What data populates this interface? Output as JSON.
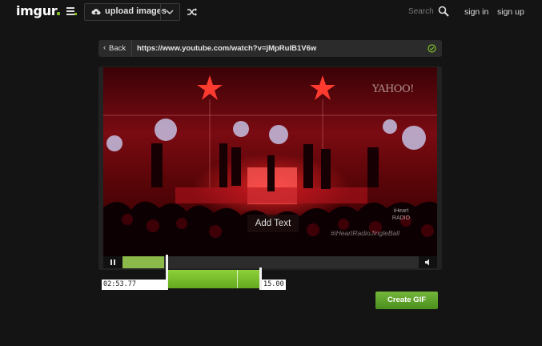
{
  "header": {
    "logo": "imgur",
    "upload_label": "upload images",
    "search_placeholder": "Search",
    "sign_in": "sign in",
    "sign_up": "sign up",
    "icons": {
      "menu": "menu-icon",
      "upload": "cloud-upload-icon",
      "dropdown": "chevron-down-icon",
      "random": "shuffle-icon",
      "search": "search-icon"
    }
  },
  "url_bar": {
    "back_label": "Back",
    "back_glyph": "‹",
    "url": "https://www.youtube.com/watch?v=jMpRuIB1V6w",
    "status_icon": "check-circle-icon",
    "status_color": "#7cc02b"
  },
  "video": {
    "overlay_watermark_top": "YAHOO!",
    "add_text_label": "Add Text",
    "corner_logo_text": "iHeart RADIO",
    "bottom_watermark": "#iHeartRadioJingleBall",
    "progress_fraction": 0.14,
    "play_icon": "pause-icon",
    "volume_icon": "volume-icon"
  },
  "trim": {
    "start_time": "02:53.77",
    "duration": "15.00"
  },
  "actions": {
    "create_gif": "Create GIF"
  },
  "colors": {
    "accent_green": "#85bf25",
    "background": "#141414"
  }
}
